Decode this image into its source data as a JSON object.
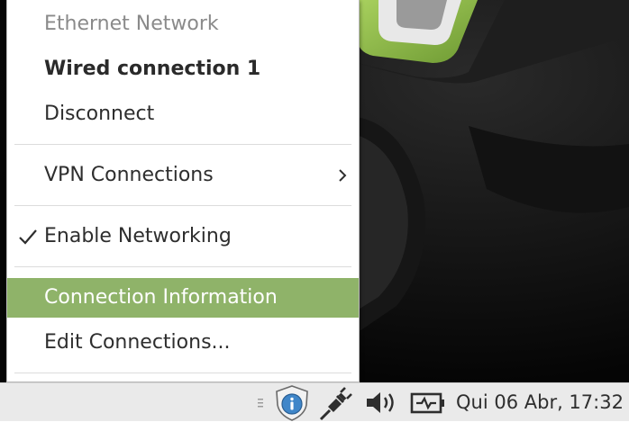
{
  "menu": {
    "header": "Ethernet Network",
    "connection_name": "Wired connection 1",
    "disconnect": "Disconnect",
    "vpn_connections": "VPN Connections",
    "enable_networking": "Enable Networking",
    "enable_networking_checked": true,
    "connection_information": "Connection Information",
    "edit_connections": "Edit Connections..."
  },
  "taskbar": {
    "clock": "Qui 06 Abr, 17:32",
    "tray_icons": [
      "handle-icon",
      "security-update-icon",
      "network-plug-icon",
      "volume-icon",
      "power-icon"
    ]
  },
  "colors": {
    "highlight": "#8fb369",
    "wallpaper_green": "#86b34a"
  }
}
